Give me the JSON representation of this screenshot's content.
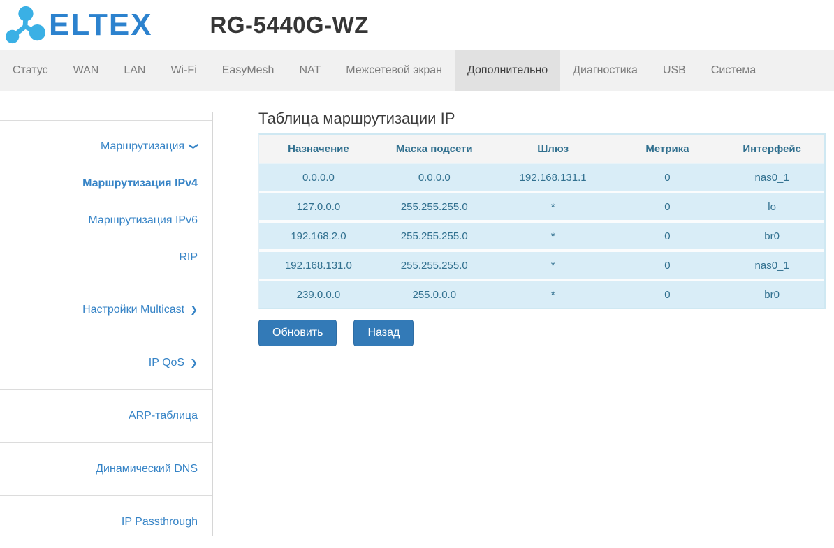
{
  "header": {
    "logo_text": "ELTEX",
    "title": "RG-5440G-WZ"
  },
  "nav": {
    "tabs": [
      {
        "name": "status",
        "label": "Статус"
      },
      {
        "name": "wan",
        "label": "WAN"
      },
      {
        "name": "lan",
        "label": "LAN"
      },
      {
        "name": "wifi",
        "label": "Wi-Fi"
      },
      {
        "name": "easymesh",
        "label": "EasyMesh"
      },
      {
        "name": "nat",
        "label": "NAT"
      },
      {
        "name": "firewall",
        "label": "Межсетевой экран"
      },
      {
        "name": "advanced",
        "label": "Дополнительно",
        "active": true
      },
      {
        "name": "diagnostics",
        "label": "Диагностика"
      },
      {
        "name": "usb",
        "label": "USB"
      },
      {
        "name": "system",
        "label": "Система"
      }
    ]
  },
  "sidebar": {
    "sections": [
      {
        "items": [
          {
            "name": "routing",
            "label": "Маршрутизация",
            "chevron": "down"
          },
          {
            "name": "routing-ipv4",
            "label": "Маршрутизация IPv4",
            "active": true
          },
          {
            "name": "routing-ipv6",
            "label": "Маршрутизация IPv6"
          },
          {
            "name": "rip",
            "label": "RIP"
          }
        ]
      },
      {
        "items": [
          {
            "name": "multicast-settings",
            "label": "Настройки Multicast",
            "chevron": "right"
          }
        ]
      },
      {
        "items": [
          {
            "name": "ip-qos",
            "label": "IP QoS",
            "chevron": "right"
          }
        ]
      },
      {
        "items": [
          {
            "name": "arp-table",
            "label": "ARP-таблица"
          }
        ]
      },
      {
        "items": [
          {
            "name": "dynamic-dns",
            "label": "Динамический DNS"
          }
        ]
      },
      {
        "items": [
          {
            "name": "ip-passthrough",
            "label": "IP Passthrough"
          }
        ]
      }
    ]
  },
  "main": {
    "title": "Таблица маршрутизации IP",
    "table": {
      "columns": [
        "Назначение",
        "Маска подсети",
        "Шлюз",
        "Метрика",
        "Интерфейс"
      ],
      "rows": [
        [
          "0.0.0.0",
          "0.0.0.0",
          "192.168.131.1",
          "0",
          "nas0_1"
        ],
        [
          "127.0.0.0",
          "255.255.255.0",
          "*",
          "0",
          "lo"
        ],
        [
          "192.168.2.0",
          "255.255.255.0",
          "*",
          "0",
          "br0"
        ],
        [
          "192.168.131.0",
          "255.255.255.0",
          "*",
          "0",
          "nas0_1"
        ],
        [
          "239.0.0.0",
          "255.0.0.0",
          "*",
          "0",
          "br0"
        ]
      ]
    },
    "buttons": {
      "refresh": "Обновить",
      "back": "Назад"
    }
  },
  "colors": {
    "accent_button_blue": "#337ab7",
    "sidebar_link_blue": "#3583c6",
    "row_bg": "#d9edf7",
    "table_text": "#31708f",
    "table_border_blue": "#cfe8f2",
    "nav_bg": "#f1f1f1",
    "nav_active_bg": "#e1e1e1",
    "logo_icon_cyan": "#3ab0e5",
    "logo_text_blue": "#2c82ce"
  }
}
